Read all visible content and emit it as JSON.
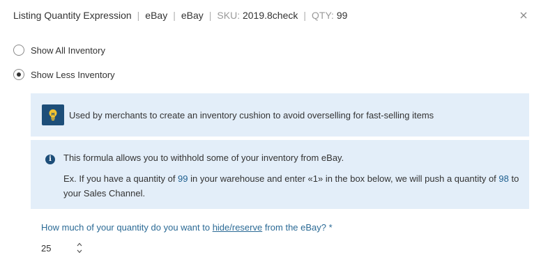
{
  "header": {
    "title": "Listing Quantity Expression",
    "separator": "|",
    "channel": "eBay",
    "account": "eBay",
    "sku_label": "SKU:",
    "sku_value": "2019.8check",
    "qty_label": "QTY:",
    "qty_value": "99"
  },
  "options": [
    {
      "label": "Show All Inventory",
      "selected": false
    },
    {
      "label": "Show Less Inventory",
      "selected": true
    }
  ],
  "tip": {
    "icon": "lightbulb-icon",
    "text": "Used by merchants to create an inventory cushion to avoid overselling for fast-selling items"
  },
  "info": {
    "icon": "info-icon",
    "line1": "This formula allows you to withhold some of your inventory from eBay.",
    "ex_part1": "Ex. If you have a quantity of ",
    "ex_qty": "99",
    "ex_part2": " in your warehouse and enter «1» in the box below, we will push a quantity of ",
    "ex_result": "98",
    "ex_part3": " to your Sales Channel."
  },
  "question": {
    "part1": "How much of your quantity do you want to ",
    "link": "hide/reserve",
    "part2": " from the eBay? *"
  },
  "quantity_input": {
    "value": "25"
  },
  "colors": {
    "accent": "#1d4e79",
    "panel_bg": "#e3eef9",
    "question_text": "#2b6a95"
  }
}
